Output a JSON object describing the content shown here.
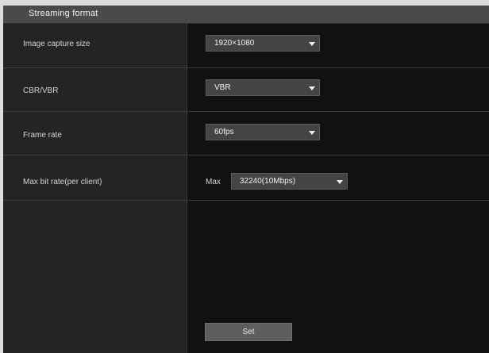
{
  "section": {
    "title": "Streaming format"
  },
  "rows": [
    {
      "label": "Image capture size",
      "value": "1920×1080"
    },
    {
      "label": "CBR/VBR",
      "value": "VBR"
    },
    {
      "label": "Frame rate",
      "value": "60fps"
    },
    {
      "label": "Max bit rate(per client)",
      "prefix": "Max",
      "value": "32240(10Mbps)"
    }
  ],
  "actions": {
    "set_label": "Set"
  }
}
